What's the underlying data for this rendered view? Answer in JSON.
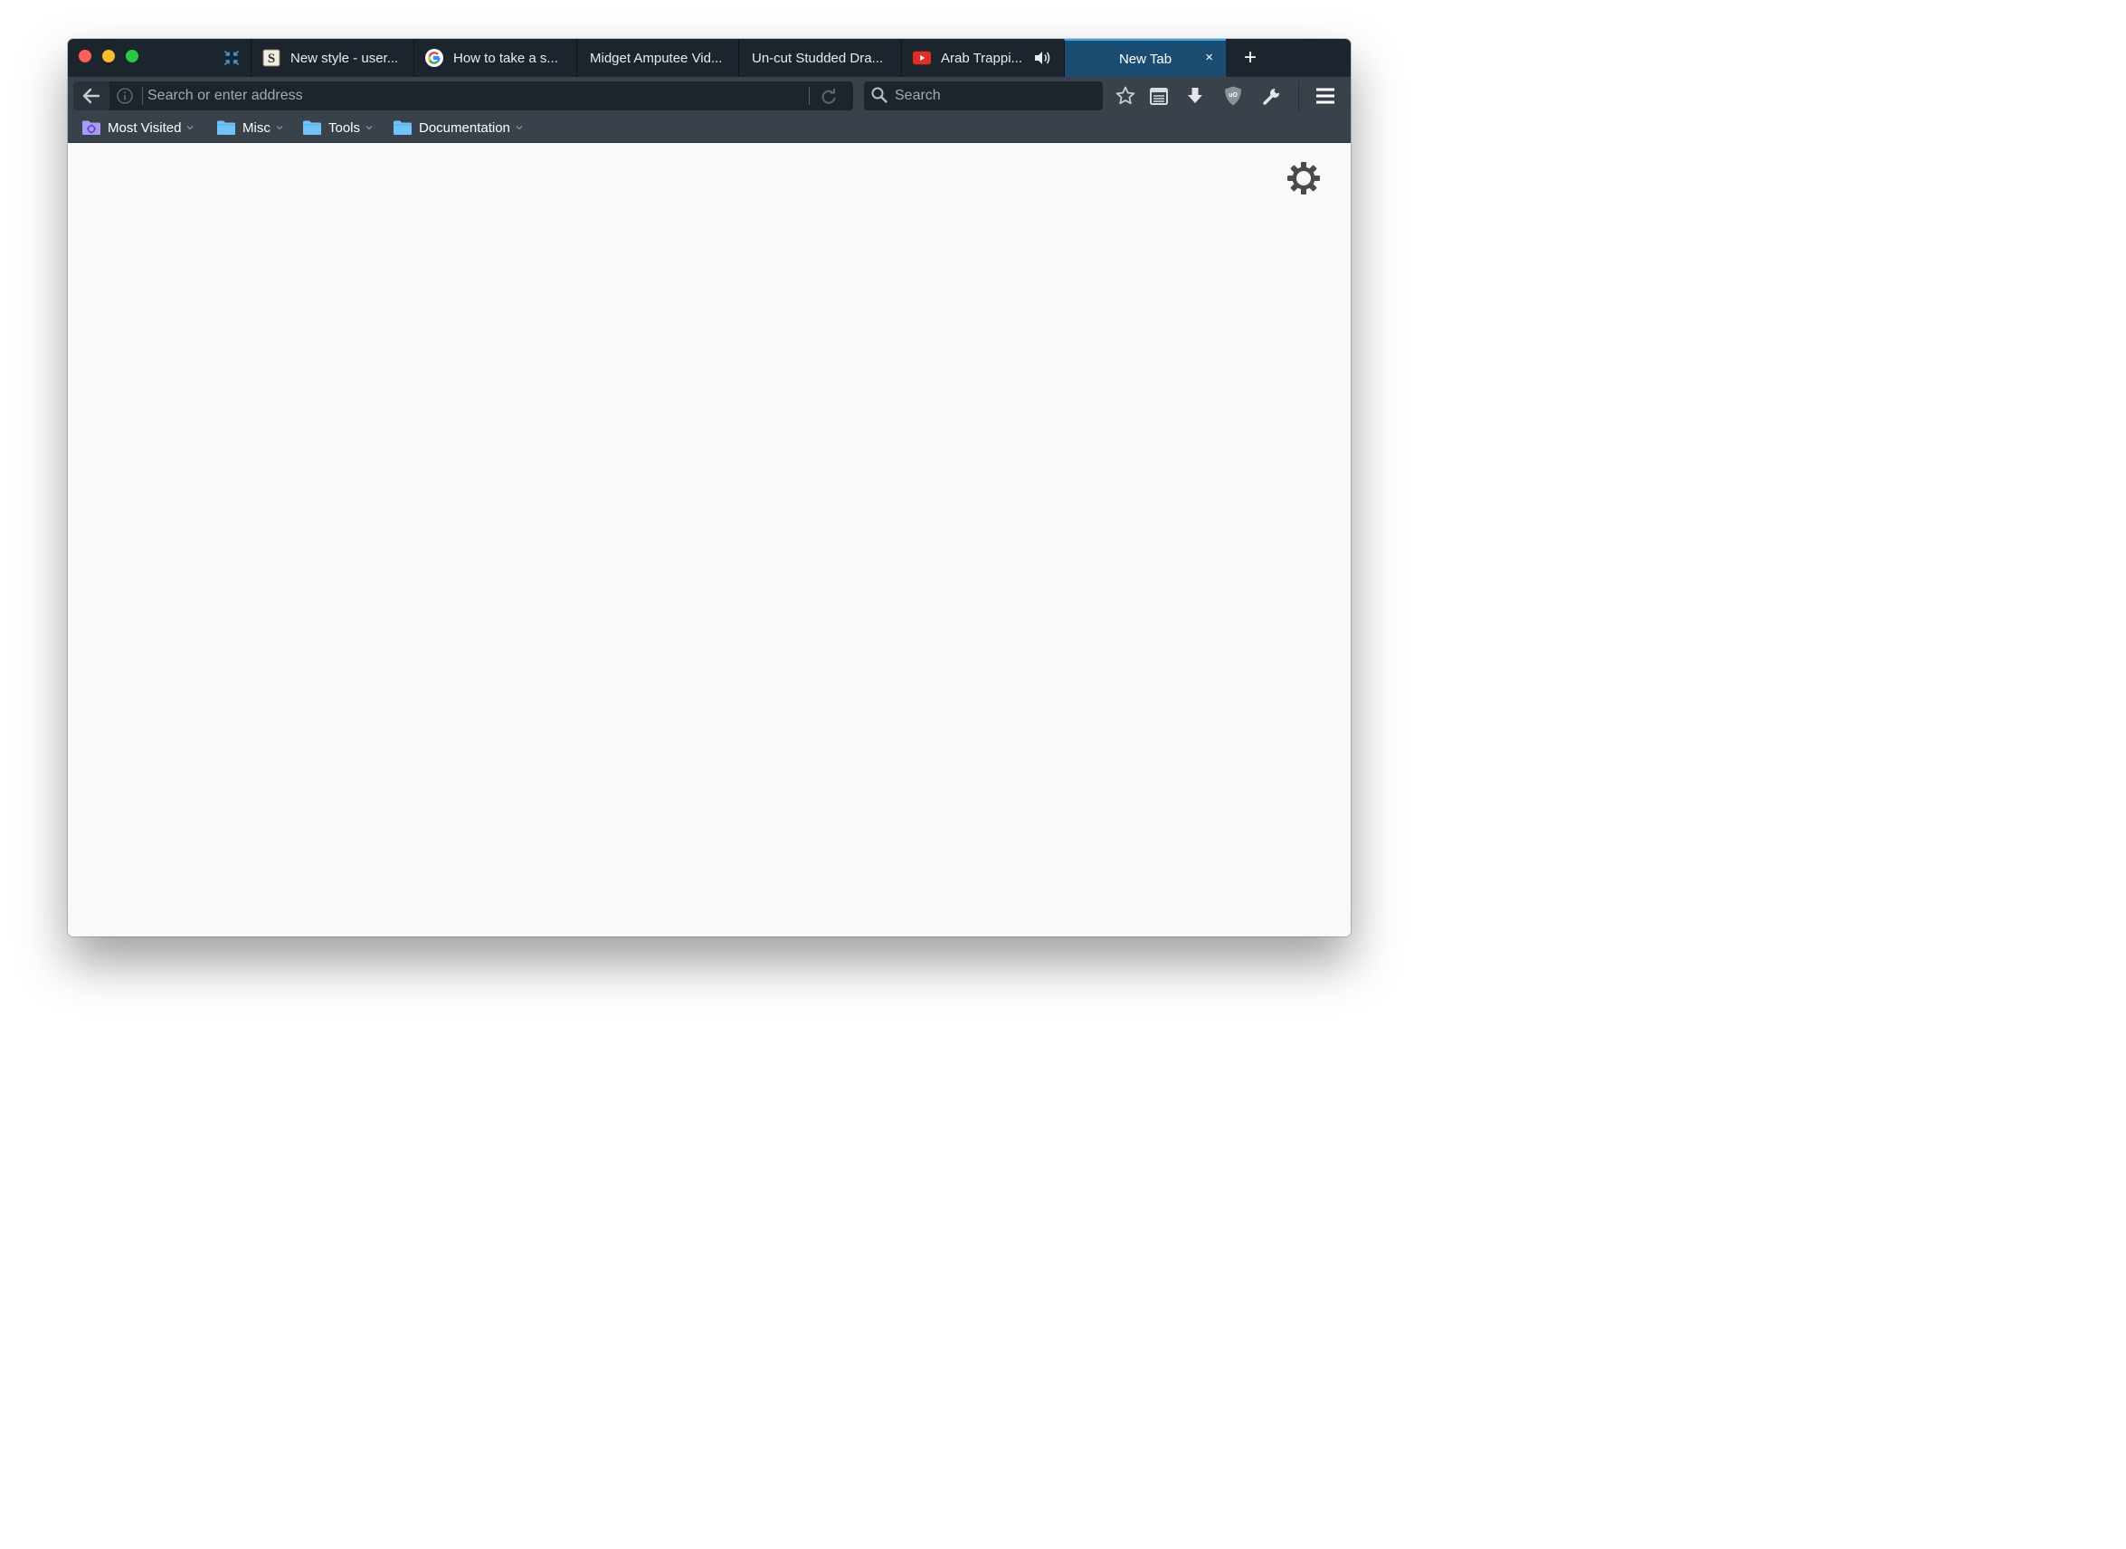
{
  "window": {
    "traffic_lights": [
      "close",
      "minimize",
      "maximize"
    ]
  },
  "tabs": [
    {
      "pinned": true,
      "icon": "compress-arrows-icon"
    },
    {
      "title": "New style - user...",
      "icon": "userstyles-s-icon"
    },
    {
      "title": "How to take a s...",
      "icon": "google-g-icon"
    },
    {
      "title": "Midget Amputee Vid...",
      "icon": ""
    },
    {
      "title": "Un-cut Studded Dra...",
      "icon": ""
    },
    {
      "title": "Arab Trappi...",
      "icon": "youtube-play-icon",
      "audio": true
    },
    {
      "title": "New Tab",
      "active": true,
      "close_label": "×"
    }
  ],
  "new_tab_label": "+",
  "navbar": {
    "url_placeholder": "Search or enter address",
    "url_value": "",
    "search_placeholder": "Search",
    "icons": [
      "back-arrow-icon",
      "info-icon",
      "reload-icon",
      "search-icon",
      "bookmark-star-icon",
      "reader-list-icon",
      "download-arrow-icon",
      "ublock-shield-icon",
      "wrench-icon",
      "hamburger-menu-icon"
    ]
  },
  "bookmarks": [
    {
      "label": "Most Visited",
      "icon": "most-visited-folder-icon"
    },
    {
      "label": "Misc",
      "icon": "folder-icon"
    },
    {
      "label": "Tools",
      "icon": "folder-icon"
    },
    {
      "label": "Documentation",
      "icon": "folder-icon"
    }
  ],
  "content": {
    "settings_icon": "gear-icon"
  },
  "colors": {
    "tabstrip": "#1c252d",
    "active_tab": "#1b4d72",
    "toolbar": "#39424b",
    "urlbar": "#1d252c",
    "page_background": "#f9f9f9",
    "folder_blue": "#6fc3f7"
  }
}
